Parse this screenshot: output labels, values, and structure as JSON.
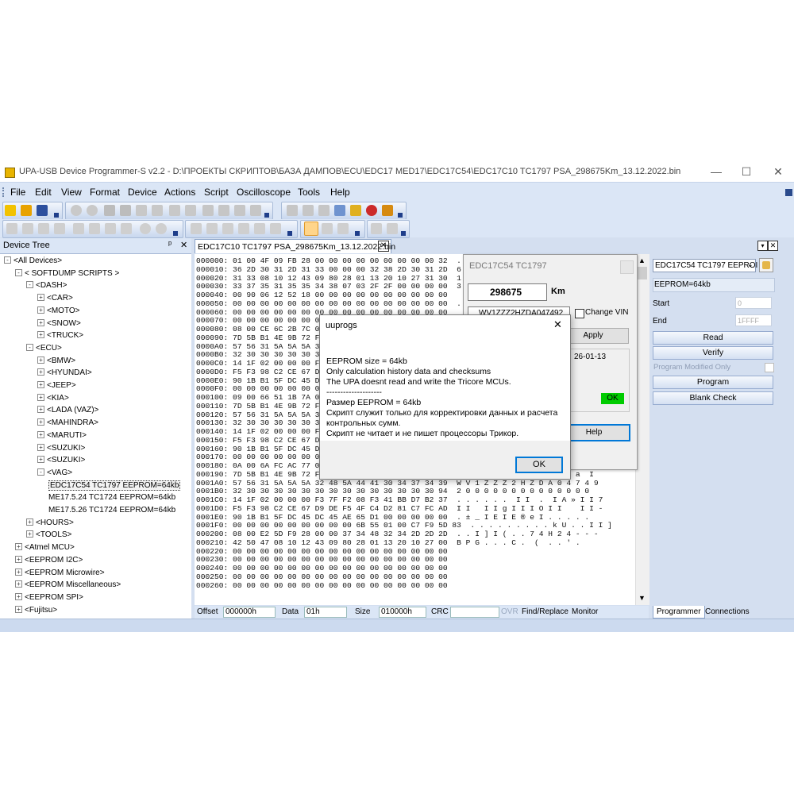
{
  "window": {
    "title": "UPA-USB Device Programmer-S v2.2 - D:\\ПРОЕКТЫ СКРИПТОВ\\БАЗА ДАМПОВ\\ECU\\EDC17 MED17\\EDC17C54\\EDC17C10 TC1797 PSA_298675Km_13.12.2022.bin",
    "min_glyph": "—",
    "max_glyph": "☐",
    "close_glyph": "✕"
  },
  "menu": [
    "File",
    "Edit",
    "View",
    "Format",
    "Device",
    "Actions",
    "Script",
    "Oscilloscope",
    "Tools",
    "Help"
  ],
  "device_tree": {
    "header": "Device Tree",
    "pin_glyph": "ᵖ",
    "close_glyph": "✕",
    "nodes": [
      {
        "label": "<All Devices>",
        "level": 0,
        "box": "-"
      },
      {
        "label": "< SOFTDUMP SCRIPTS >",
        "level": 1,
        "box": "-"
      },
      {
        "label": "<DASH>",
        "level": 2,
        "box": "-"
      },
      {
        "label": "<CAR>",
        "level": 3,
        "box": "+"
      },
      {
        "label": "<MOTO>",
        "level": 3,
        "box": "+"
      },
      {
        "label": "<SNOW>",
        "level": 3,
        "box": "+"
      },
      {
        "label": "<TRUCK>",
        "level": 3,
        "box": "+"
      },
      {
        "label": "<ECU>",
        "level": 2,
        "box": "-"
      },
      {
        "label": "<BMW>",
        "level": 3,
        "box": "+"
      },
      {
        "label": "<HYUNDAI>",
        "level": 3,
        "box": "+"
      },
      {
        "label": "<JEEP>",
        "level": 3,
        "box": "+"
      },
      {
        "label": "<KIA>",
        "level": 3,
        "box": "+"
      },
      {
        "label": "<LADA (VAZ)>",
        "level": 3,
        "box": "+"
      },
      {
        "label": "<MAHINDRA>",
        "level": 3,
        "box": "+"
      },
      {
        "label": "<MARUTI>",
        "level": 3,
        "box": "+"
      },
      {
        "label": "<SUZUKI>",
        "level": 3,
        "box": "+"
      },
      {
        "label": "<SUZUKI>",
        "level": 3,
        "box": "+"
      },
      {
        "label": "<VAG>",
        "level": 3,
        "box": "-"
      },
      {
        "label": "EDC17C54 TC1797 EEPROM=64kb",
        "level": 4,
        "box": "",
        "selected": true
      },
      {
        "label": "ME17.5.24 TC1724 EEPROM=64kb",
        "level": 4,
        "box": ""
      },
      {
        "label": "ME17.5.26 TC1724 EEPROM=64kb",
        "level": 4,
        "box": ""
      },
      {
        "label": "<HOURS>",
        "level": 2,
        "box": "+"
      },
      {
        "label": "<TOOLS>",
        "level": 2,
        "box": "+"
      },
      {
        "label": "<Atmel MCU>",
        "level": 1,
        "box": "+"
      },
      {
        "label": "<EEPROM I2C>",
        "level": 1,
        "box": "+"
      },
      {
        "label": "<EEPROM Microwire>",
        "level": 1,
        "box": "+"
      },
      {
        "label": "<EEPROM Miscellaneous>",
        "level": 1,
        "box": "+"
      },
      {
        "label": "<EEPROM SPI>",
        "level": 1,
        "box": "+"
      },
      {
        "label": "<Fujitsu>",
        "level": 1,
        "box": "+"
      }
    ]
  },
  "doc_tab": {
    "label": "EDC17C10 TC1797 PSA_298675Km_13.12.2022.bin",
    "close_glyph": "✕"
  },
  "hex_rows": [
    "000000: 01 00 4F 09 FB 28 00 00 00 00 00 00 00 00 00 32  . O",
    "000010: 36 2D 30 31 2D 31 33 00 00 00 32 38 2D 30 31 2D  6 - 0 1",
    "000020: 31 33 08 10 12 43 09 80 28 01 13 20 10 27 31 30  1 3 . .",
    "000030: 33 37 35 31 35 35 34 38 07 03 2F 2F 00 00 00 00  3 7 5 1",
    "000040: 00 90 06 12 52 18 00 00 00 00 00 00 00 00 00 00",
    "000050: 00 00 00 00 00 00 00 00 00 00 00 00 00 00 00 00  . . . .",
    "000060: 00 00 00 00 00 00 00 00 00 00 00 00 00 00 00 00",
    "000070: 00 00 00 00 00 00 00 00",
    "000080: 08 00 CE 6C 2B 7C 01 00",
    "000090: 7D 5B B1 4E 9B 72 FA 00",
    "0000A0: 57 56 31 5A 5A 5A 32 48",
    "0000B0: 32 30 30 30 30 30 30 30",
    "0000C0: 14 1F 02 00 00 00 F3 7F",
    "0000D0: F5 F3 98 C2 CE 67 D9 DE",
    "0000E0: 90 1B B1 5F DC 45 DC 45",
    "0000F0: 00 00 00 00 00 00 00 00",
    "000100: 09 00 66 51 1B 7A 01 00",
    "000110: 7D 5B B1 4E 9B 72 FA 00",
    "000120: 57 56 31 5A 5A 5A 32 48",
    "000130: 32 30 30 30 30 30 30 30",
    "000140: 14 1F 02 00 00 00 F3 7F",
    "000150: F5 F3 98 C2 CE 67 D9 DE",
    "000160: 90 1B B1 5F DC 45 DC 45",
    "000170: 00 00 00 00 00 00 00 00",
    "000180: 0A 00 6A FC AC 77 01 00 F4 07 DE FF 70 48 A4 A0  . . . ш . . . I I p P ¤",
    "000190: 7D 5B B1 4E 9B 72 FA 8D E1 B3 B3 B3 B0 61 00 AA  } [ ± N  r I    I I I I ° a  I",
    "0001A0: 57 56 31 5A 5A 5A 32 48 5A 44 41 30 34 37 34 39  W V 1 Z Z Z 2 H Z D A 0 4 7 4 9",
    "0001B0: 32 30 30 30 30 30 30 30 30 30 30 30 30 30 30 94  2 0 0 0 0 0 0 0 0 0 0 0 0 0 0",
    "0001C0: 14 1F 02 00 00 00 F3 7F F2 08 F3 41 BB D7 B2 37  . . . . . .  I I  .  I A » I I 7",
    "0001D0: F5 F3 98 C2 CE 67 D9 DE F5 4F C4 D2 81 C7 FC AD  I I   I I g I I I O I I    I I -",
    "0001E0: 90 1B B1 5F DC 45 DC 45 AE 65 D1 00 00 00 00 00  . ± _ I E I E ® e I . . . . .",
    "0001F0: 00 00 00 00 00 00 00 00 00 6B 55 01 00 C7 F9 5D 83  . . . . . . . . . k U . . I I ]",
    "000200: 08 00 E2 5D F9 28 00 00 37 34 48 32 34 2D 2D 2D  . . I ] I ( . . 7 4 H 2 4 - - -",
    "000210: 42 50 47 08 10 12 43 09 80 28 01 13 20 10 27 00  B P G . . . C .  (  . . ' .",
    "000220: 00 00 00 00 00 00 00 00 00 00 00 00 00 00 00 00",
    "000230: 00 00 00 00 00 00 00 00 00 00 00 00 00 00 00 00",
    "000240: 00 00 00 00 00 00 00 00 00 00 00 00 00 00 00 00",
    "000250: 00 00 00 00 00 00 00 00 00 00 00 00 00 00 00 00",
    "000260: 00 00 00 00 00 00 00 00 00 00 00 00 00 00 00 00"
  ],
  "status": {
    "offset_label": "Offset",
    "offset_value": "000000h",
    "data_label": "Data",
    "data_value": "01h",
    "size_label": "Size",
    "size_value": "010000h",
    "crc_label": "CRC",
    "ovr": "OVR",
    "find_replace": "Find/Replace",
    "monitor": "Monitor"
  },
  "script_dialog": {
    "title": "EDC17C54 TC1797",
    "km_value": "298675",
    "km_unit": "Km",
    "vin_value": "WV1ZZZ2HZDA047492",
    "change_vin_label": "Change VIN",
    "apply_label": "Apply",
    "date_text": "26-01-13",
    "ok_badge": "OK",
    "help_label": "Help",
    "ok_color": "#00cc00"
  },
  "message_box": {
    "title": "uuprogs",
    "lines": [
      "EEPROM size = 64kb",
      "Only calculation history data and checksums",
      "The UPA doesnt read and write the Tricore MCUs.",
      "--------------------",
      "Размер EEPROM = 64kb",
      "Скрипт служит только для корректировки данных и расчета",
      "контрольных сумм.",
      "Скрипт не читает и не пишет процессоры Трикор."
    ],
    "ok_label": "OK",
    "close_glyph": "✕"
  },
  "right_panel": {
    "device_select": "EDC17C54 TC1797 EEPROI",
    "eeprom_label": "EEPROM=64kb",
    "start_label": "Start",
    "start_value": "0",
    "end_label": "End",
    "end_value": "1FFFF",
    "read_label": "Read",
    "verify_label": "Verify",
    "modified_label": "Program Modified Only",
    "program_label": "Program",
    "blank_label": "Blank Check"
  },
  "bottom_tabs": {
    "programmer": "Programmer",
    "connections": "Connections"
  }
}
